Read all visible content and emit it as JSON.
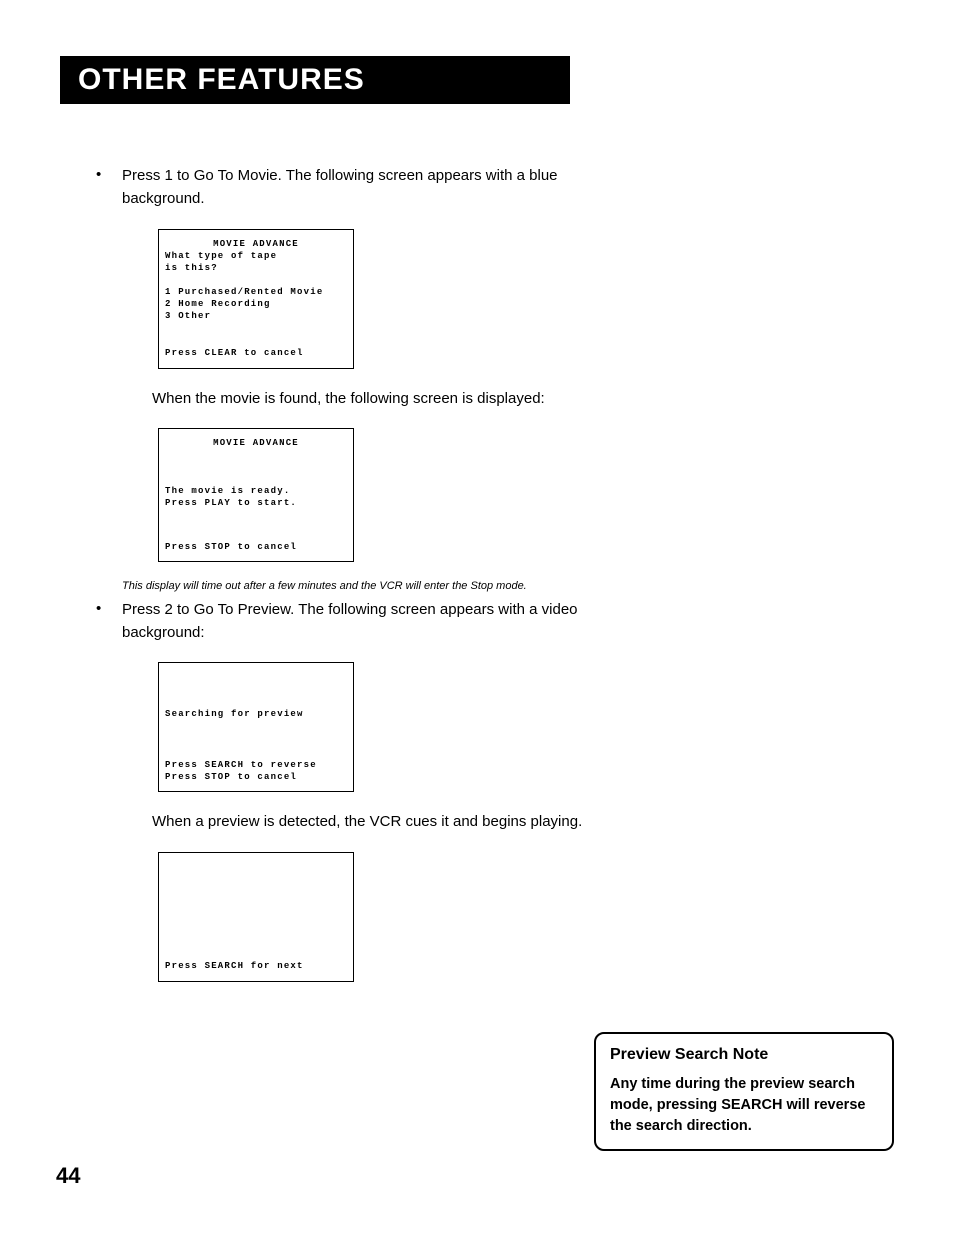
{
  "header": "OTHER FEATURES",
  "bullet1": "Press 1 to Go To Movie. The following screen appears with a blue background.",
  "screen1": {
    "title": "MOVIE ADVANCE",
    "q1": "What type of tape",
    "q2": "is this?",
    "opt1": "1 Purchased/Rented Movie",
    "opt2": "2 Home Recording",
    "opt3": "3 Other",
    "cancel": "Press CLEAR to cancel"
  },
  "para1": "When the movie is found, the following screen is displayed:",
  "screen2": {
    "title": "MOVIE ADVANCE",
    "l1": "The movie is ready.",
    "l2": "Press PLAY to start.",
    "cancel": "Press STOP to cancel"
  },
  "caption": "This display will time out after a few minutes and the VCR will enter the Stop mode.",
  "bullet2": "Press 2 to Go To Preview. The following screen appears with a video background:",
  "screen3": {
    "l1": "Searching for preview",
    "l2": "Press SEARCH to reverse",
    "l3": "Press STOP to cancel"
  },
  "para2": "When a preview is detected, the VCR cues it and begins playing.",
  "screen4": {
    "l1": "Press SEARCH for next"
  },
  "note": {
    "title": "Preview Search Note",
    "body": "Any time during the preview search mode, pressing SEARCH will reverse the search direction."
  },
  "pagenum": "44"
}
